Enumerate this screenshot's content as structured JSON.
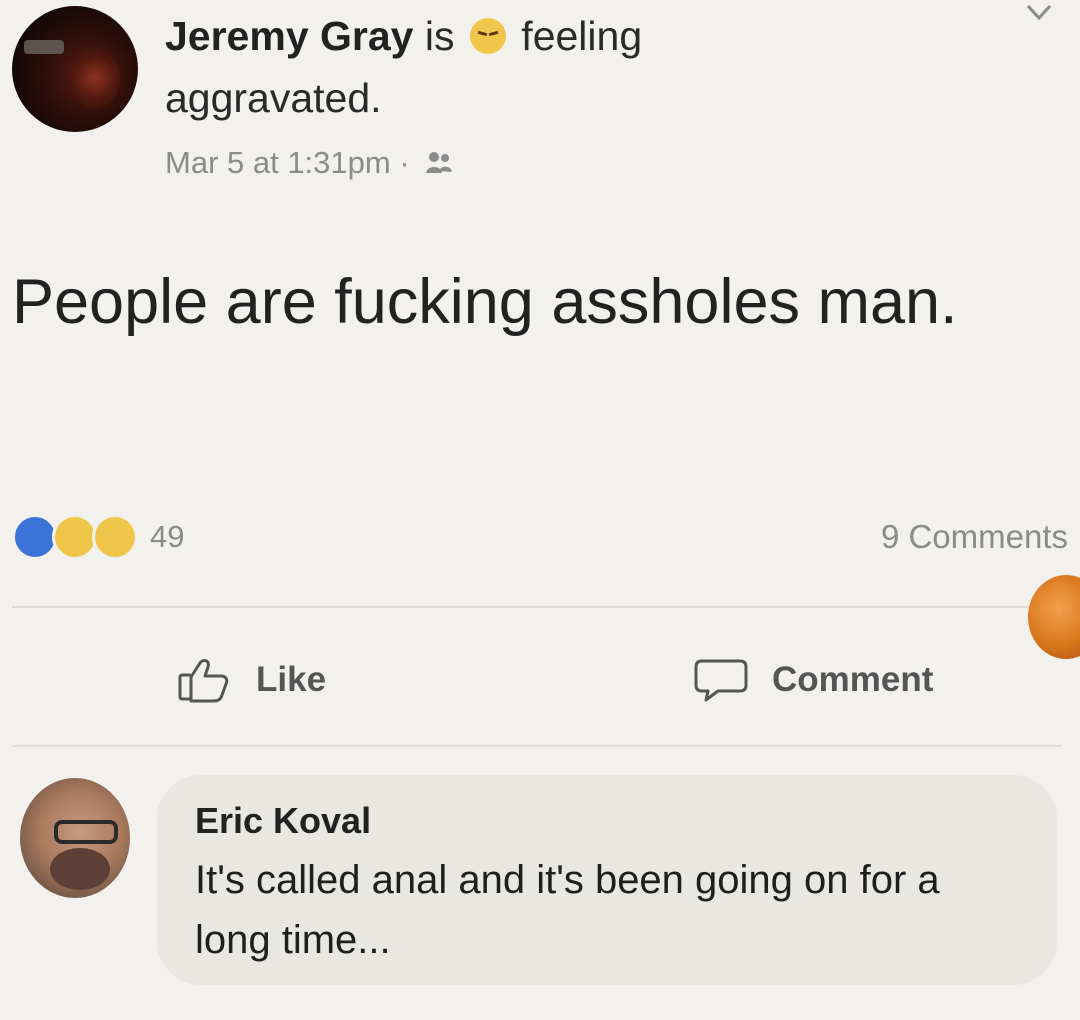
{
  "post": {
    "author": "Jeremy Gray",
    "is_text": "is",
    "feeling_text": "feeling",
    "mood": "aggravated.",
    "timestamp": "Mar 5 at 1:31pm",
    "separator": "·",
    "body": "People are fucking assholes man.",
    "reaction_count": "49",
    "comments_count": "9 Comments",
    "like_label": "Like",
    "comment_label": "Comment"
  },
  "comment": {
    "author": "Eric Koval",
    "text": "It's called anal and it's been going on for a long time..."
  },
  "icons": {
    "feeling": "angry-face-icon",
    "audience": "friends-icon",
    "menu": "chevron-down-icon",
    "like_action": "thumbs-up-icon",
    "comment_action": "speech-bubble-icon",
    "reaction_like": "like-reaction-icon",
    "reaction_sad": "sad-reaction-icon",
    "reaction_wow": "wow-reaction-icon"
  },
  "colors": {
    "background": "#f3f1ed",
    "text_primary": "#222222",
    "text_secondary": "#8b8b8b",
    "like_blue": "#3b73d8",
    "reaction_yellow": "#f0c64a",
    "comment_bubble": "#e9e7e2"
  }
}
